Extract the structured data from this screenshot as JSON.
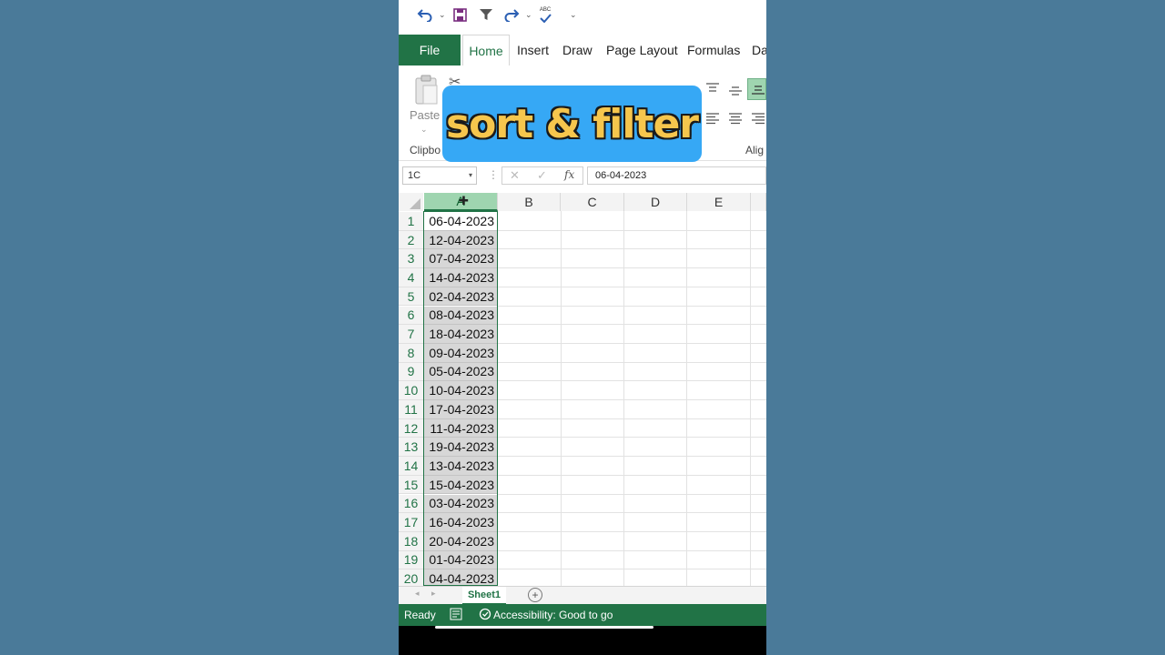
{
  "qat": {
    "spell_icon_text": "ABC"
  },
  "tabs": [
    "File",
    "Home",
    "Insert",
    "Draw",
    "Page Layout",
    "Formulas",
    "Da"
  ],
  "ribbon": {
    "paste_label": "Paste",
    "clipboard_label": "Clipbo",
    "alignment_label": "Alig"
  },
  "banner": {
    "text": "sort & filter"
  },
  "formula_bar": {
    "name_box": "1C",
    "fx": "fx",
    "value": "06-04-2023"
  },
  "columns": [
    "A",
    "B",
    "C",
    "D",
    "E"
  ],
  "rows": [
    {
      "n": "1",
      "a": "06-04-2023"
    },
    {
      "n": "2",
      "a": "12-04-2023"
    },
    {
      "n": "3",
      "a": "07-04-2023"
    },
    {
      "n": "4",
      "a": "14-04-2023"
    },
    {
      "n": "5",
      "a": "02-04-2023"
    },
    {
      "n": "6",
      "a": "08-04-2023"
    },
    {
      "n": "7",
      "a": "18-04-2023"
    },
    {
      "n": "8",
      "a": "09-04-2023"
    },
    {
      "n": "9",
      "a": "05-04-2023"
    },
    {
      "n": "10",
      "a": "10-04-2023"
    },
    {
      "n": "11",
      "a": "17-04-2023"
    },
    {
      "n": "12",
      "a": "11-04-2023"
    },
    {
      "n": "13",
      "a": "19-04-2023"
    },
    {
      "n": "14",
      "a": "13-04-2023"
    },
    {
      "n": "15",
      "a": "15-04-2023"
    },
    {
      "n": "16",
      "a": "03-04-2023"
    },
    {
      "n": "17",
      "a": "16-04-2023"
    },
    {
      "n": "18",
      "a": "20-04-2023"
    },
    {
      "n": "19",
      "a": "01-04-2023"
    },
    {
      "n": "20",
      "a": "04-04-2023"
    }
  ],
  "sheet": {
    "tab": "Sheet1",
    "add": "+"
  },
  "status": {
    "ready": "Ready",
    "accessibility": "Accessibility: Good to go"
  },
  "colors": {
    "excel_green": "#217346",
    "banner_bg": "#36a8f5",
    "banner_text": "#f6c64d",
    "selection_fill": "#d7d7d7"
  }
}
